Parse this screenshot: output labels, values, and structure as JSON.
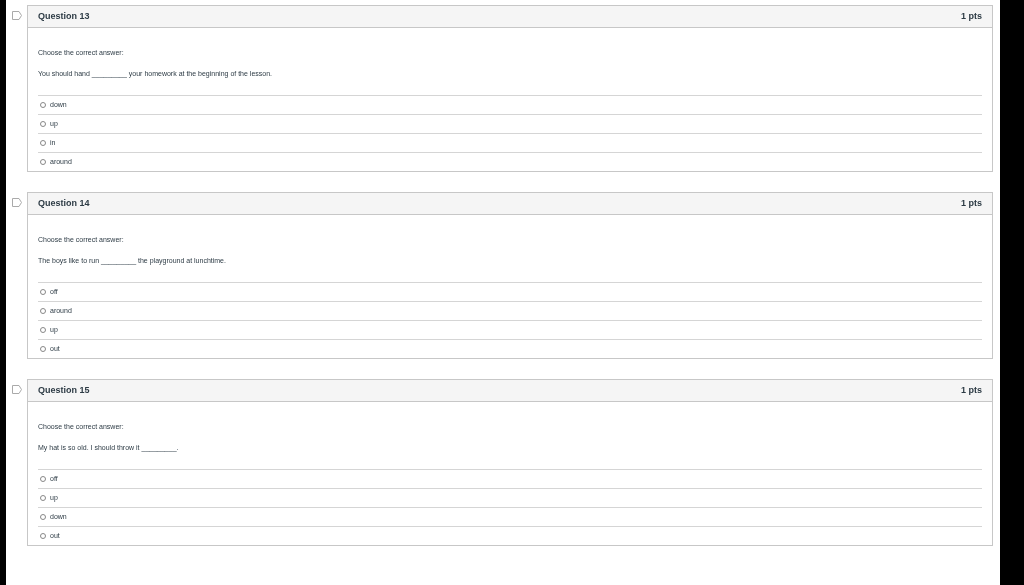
{
  "questions": [
    {
      "title": "Question 13",
      "points": "1 pts",
      "instruction": "Choose the correct answer:",
      "text": "You should hand _________ your homework at the beginning of the lesson.",
      "answers": [
        {
          "label": "down",
          "selected": false
        },
        {
          "label": "up",
          "selected": false
        },
        {
          "label": "in",
          "selected": false
        },
        {
          "label": "around",
          "selected": false
        }
      ]
    },
    {
      "title": "Question 14",
      "points": "1 pts",
      "instruction": "Choose the correct answer:",
      "text": "The boys like to run _________ the playground at lunchtime.",
      "answers": [
        {
          "label": "off",
          "selected": false
        },
        {
          "label": "around",
          "selected": false
        },
        {
          "label": "up",
          "selected": false
        },
        {
          "label": "out",
          "selected": false
        }
      ]
    },
    {
      "title": "Question 15",
      "points": "1 pts",
      "instruction": "Choose the correct answer:",
      "text": "My hat is so old. I should throw it _________.",
      "answers": [
        {
          "label": "off",
          "selected": false
        },
        {
          "label": "up",
          "selected": false
        },
        {
          "label": "down",
          "selected": false
        },
        {
          "label": "out",
          "selected": false
        }
      ]
    }
  ]
}
